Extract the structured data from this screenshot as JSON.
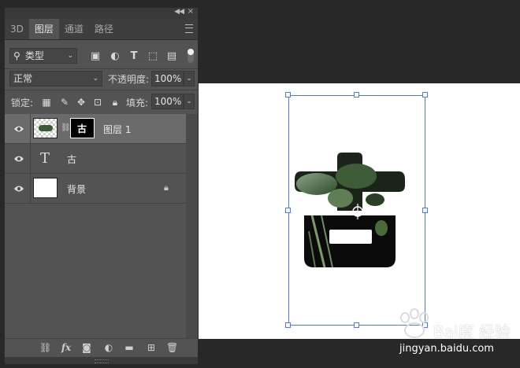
{
  "panel": {
    "tabs": [
      {
        "label": "3D",
        "active": false
      },
      {
        "label": "图层",
        "active": true
      },
      {
        "label": "通道",
        "active": false
      },
      {
        "label": "路径",
        "active": false
      }
    ],
    "filter": {
      "kind_label": "类型",
      "icons": [
        "image-filter-icon",
        "adjustment-filter-icon",
        "type-filter-icon",
        "shape-filter-icon",
        "smart-object-filter-icon"
      ]
    },
    "blend_mode": "正常",
    "opacity_label": "不透明度:",
    "opacity_value": "100%",
    "lock_label": "锁定:",
    "fill_label": "填充:",
    "fill_value": "100%",
    "layers": [
      {
        "name": "图层 1",
        "selected": true,
        "visible": true,
        "mask_glyph": "古"
      },
      {
        "name": "古",
        "selected": false,
        "visible": true,
        "kind_glyph": "T"
      },
      {
        "name": "背景",
        "selected": false,
        "visible": true,
        "locked": true
      }
    ],
    "bottom_icons": [
      "link-layers-icon",
      "fx-icon",
      "add-mask-icon",
      "adjustment-layer-icon",
      "new-group-icon",
      "new-layer-icon",
      "delete-icon"
    ],
    "fx_label": "fx"
  },
  "watermark": {
    "brand": "Bai度 经验",
    "url": "jingyan.baidu.com"
  },
  "colors": {
    "panel_bg": "#535353",
    "workspace_bg": "#282828",
    "selection_row": "#6b6b6b",
    "bbox": "#4c7bd9"
  }
}
